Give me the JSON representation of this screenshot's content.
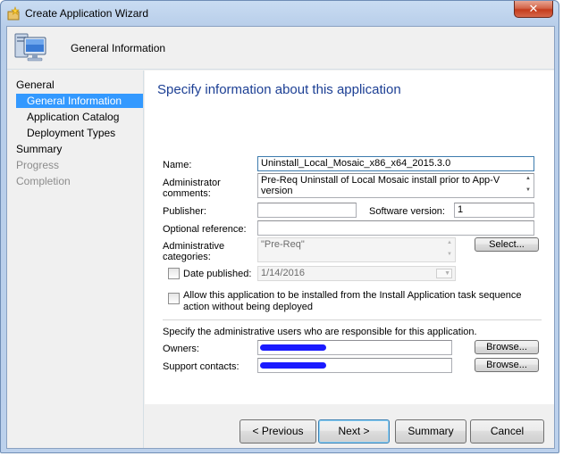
{
  "window": {
    "title": "Create Application Wizard",
    "close_glyph": "✕"
  },
  "header": {
    "title": "General Information"
  },
  "nav": {
    "items": [
      {
        "label": "General",
        "state": "normal"
      },
      {
        "label": "General Information",
        "state": "selected"
      },
      {
        "label": "Application Catalog",
        "state": "normal"
      },
      {
        "label": "Deployment Types",
        "state": "normal"
      },
      {
        "label": "Summary",
        "state": "normal"
      },
      {
        "label": "Progress",
        "state": "disabled"
      },
      {
        "label": "Completion",
        "state": "disabled"
      }
    ]
  },
  "content": {
    "title": "Specify information about this application",
    "name_label": "Name:",
    "name_value": "Uninstall_Local_Mosaic_x86_x64_2015.3.0",
    "admin_comments_label_1": "Administrator",
    "admin_comments_label_2": "comments:",
    "admin_comments_value": "Pre-Req Uninstall of Local Mosaic install prior to App-V version",
    "publisher_label": "Publisher:",
    "publisher_value": "",
    "software_version_label": "Software version:",
    "software_version_value": "1",
    "optional_reference_label": "Optional reference:",
    "optional_reference_value": "",
    "admin_categories_label_1": "Administrative",
    "admin_categories_label_2": "categories:",
    "admin_categories_value": "\"Pre-Req\"",
    "select_button": "Select...",
    "date_published_label": "Date published:",
    "date_published_value": "1/14/2016",
    "allow_install_line_1": "Allow this application to be installed from the Install Application task sequence",
    "allow_install_line_2": "action without being deployed",
    "responsible_text": "Specify the administrative users who are responsible for this application.",
    "owners_label": "Owners:",
    "support_contacts_label": "Support contacts:",
    "browse_button": "Browse..."
  },
  "footer": {
    "previous": "< Previous",
    "next": "Next >",
    "summary": "Summary",
    "cancel": "Cancel"
  },
  "colors": {
    "title_accent": "#1c3f94",
    "selection": "#3399ff",
    "redaction": "#1a1aff"
  },
  "icons": {
    "title": "wizard-app-icon",
    "header": "computer-monitor-icon",
    "close": "close-icon",
    "spin": "scroll-arrow-icon",
    "calendar": "calendar-dropdown-icon"
  }
}
